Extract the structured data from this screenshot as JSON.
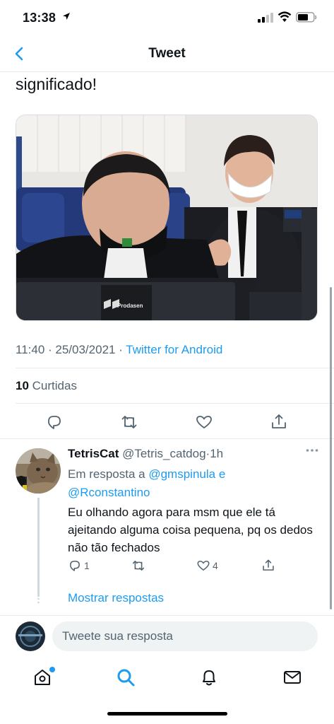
{
  "status_bar": {
    "time": "13:38"
  },
  "nav": {
    "title": "Tweet"
  },
  "tweet": {
    "text": "significado!",
    "time": "11:40",
    "date": "25/03/2021",
    "source": "Twitter for Android",
    "likes_count": "10",
    "likes_label": "Curtidas",
    "image_overlay_text": "Prodasen"
  },
  "reply": {
    "name": "TetrisCat",
    "handle": "@Tetris_catdog",
    "time": "1h",
    "replying_prefix": "Em resposta a",
    "mention1": "@gmspinula",
    "conjunction": "e",
    "mention2": "@Rconstantino",
    "body": "Eu olhando agora para msm que ele tá ajeitando alguma coisa pequena, pq os dedos não tão fechados",
    "reply_count": "1",
    "like_count": "4",
    "show_replies": "Mostrar respostas"
  },
  "compose": {
    "placeholder": "Tweete sua resposta"
  },
  "colors": {
    "accent": "#1d9bf0",
    "secondary_text": "#536471",
    "divider": "#e6ecf0"
  }
}
